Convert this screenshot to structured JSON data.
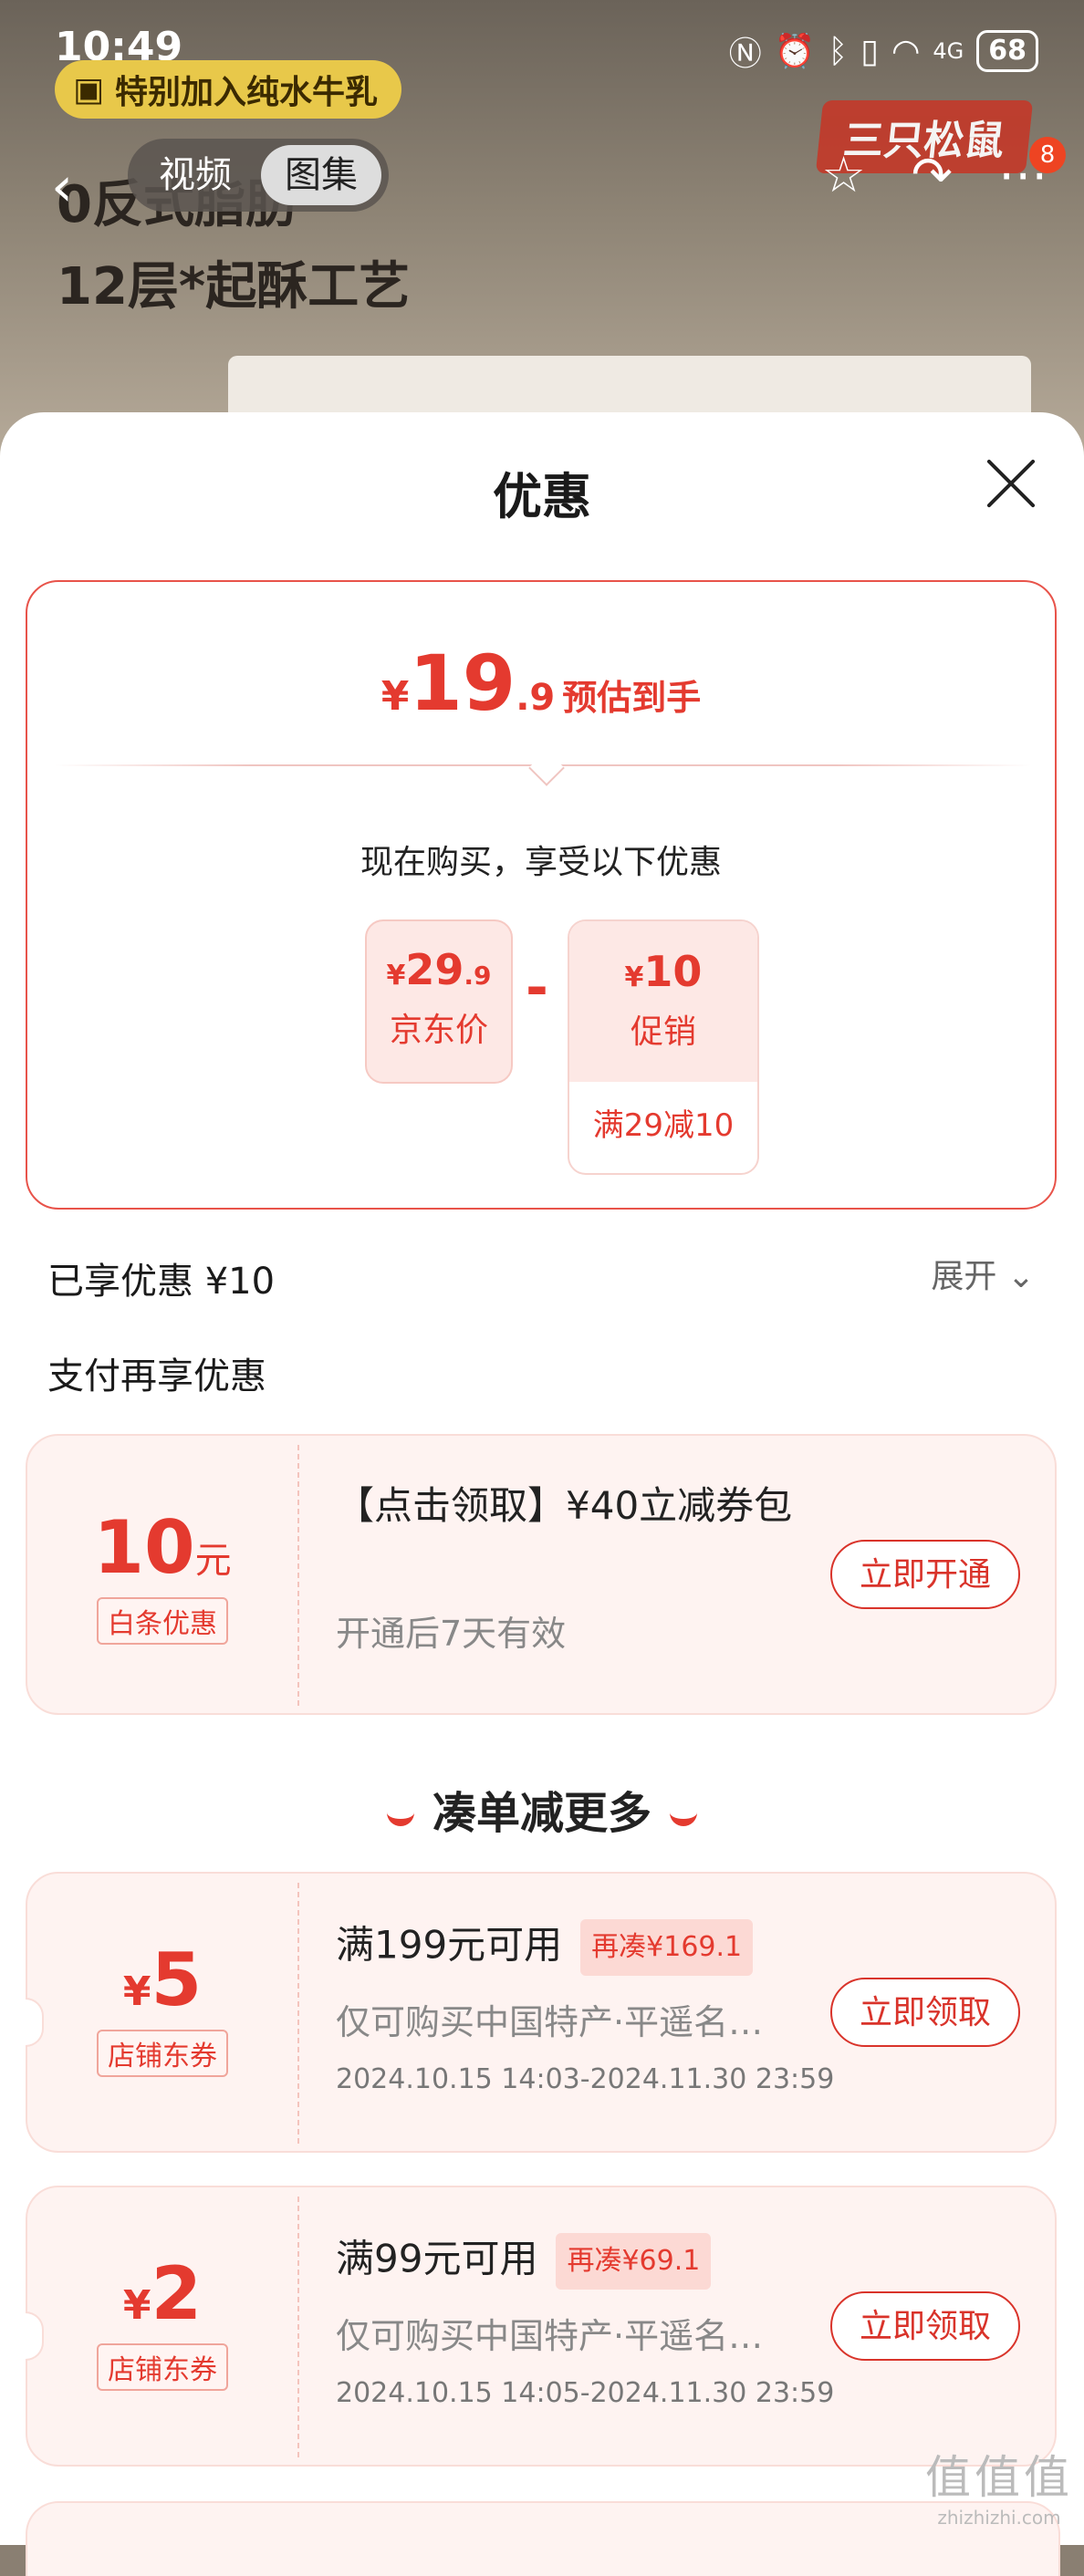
{
  "status_bar": {
    "time": "10:49",
    "battery": "68",
    "network": "4G"
  },
  "background": {
    "promo_chip": "特别加入纯水牛乳",
    "media_tabs": [
      "视频",
      "图集"
    ],
    "headline_line1": "0反式脂肪",
    "headline_line2": "12层*起酥工艺",
    "brand_logo": "三只松鼠",
    "cart_badge": "8"
  },
  "sheet": {
    "title": "优惠",
    "estimate": {
      "currency": "¥",
      "integer": "19",
      "decimal": ".9",
      "label": "预估到手"
    },
    "now_buy_text": "现在购买，享受以下优惠",
    "jd_price": {
      "currency": "¥",
      "integer": "29",
      "decimal": ".9",
      "label": "京东价"
    },
    "minus": "-",
    "promo": {
      "currency": "¥",
      "value": "10",
      "label": "促销",
      "rule": "满29减10"
    },
    "enjoyed": "已享优惠 ¥10",
    "expand": "展开",
    "pay_more": "支付再享优惠",
    "baitiao": {
      "amount": "10",
      "unit": "元",
      "tag": "白条优惠",
      "title": "【点击领取】¥40立减券包",
      "sub": "开通后7天有效",
      "button": "立即开通"
    },
    "section_head": "凑单减更多",
    "coupons": [
      {
        "currency": "¥",
        "amount": "5",
        "tag": "店铺东券",
        "title": "满199元可用",
        "add_more": "再凑¥169.1",
        "desc": "仅可购买中国特产·平遥名…",
        "date": "2024.10.15 14:03-2024.11.30 23:59",
        "button": "立即领取"
      },
      {
        "currency": "¥",
        "amount": "2",
        "tag": "店铺东券",
        "title": "满99元可用",
        "add_more": "再凑¥69.1",
        "desc": "仅可购买中国特产·平遥名…",
        "date": "2024.10.15 14:05-2024.11.30 23:59",
        "button": "立即领取"
      }
    ]
  },
  "watermark": {
    "glyphs": "值值值",
    "url": "zhizhizhi.com"
  }
}
